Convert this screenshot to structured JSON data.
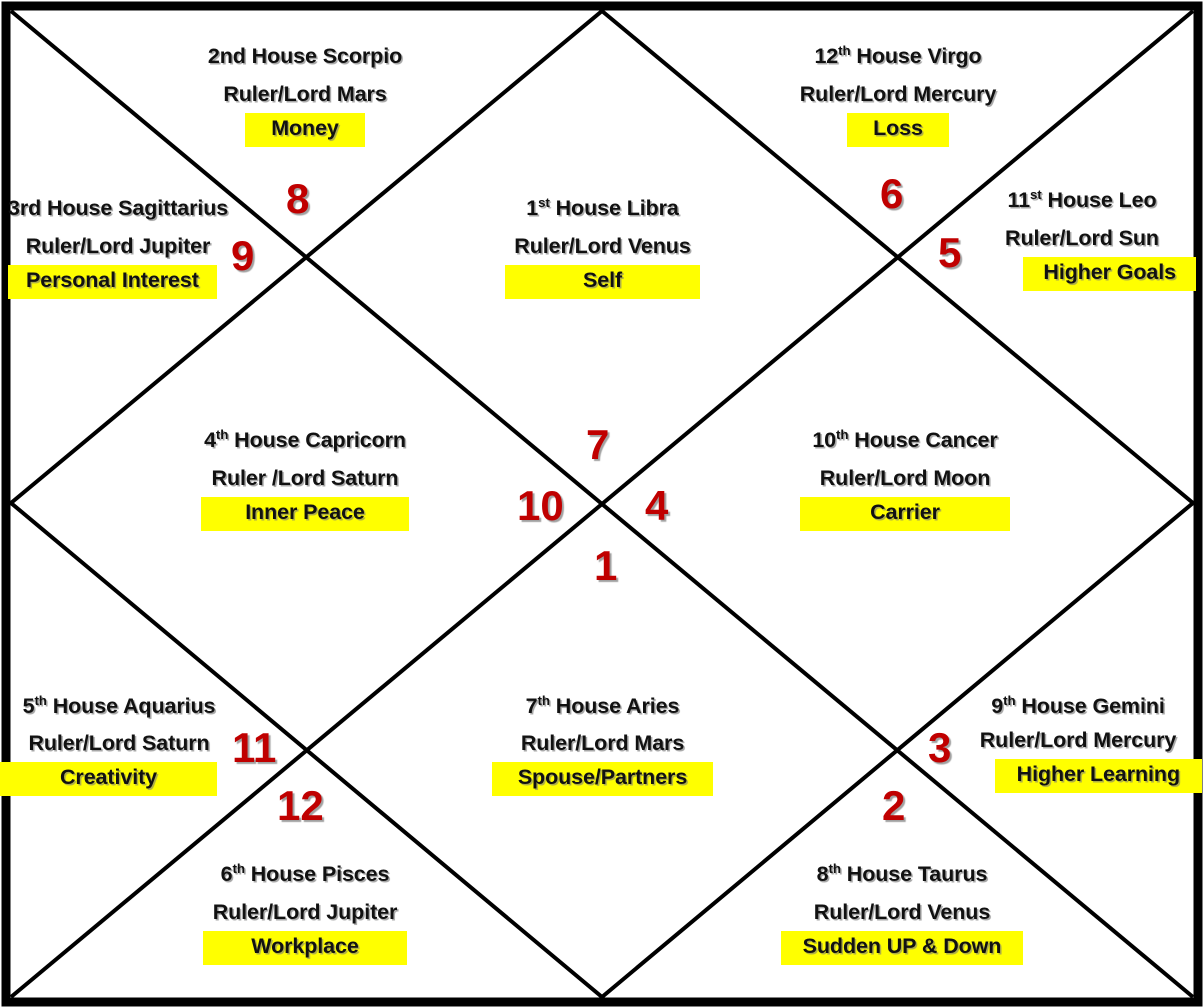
{
  "chart": {
    "kind": "north-indian-vedic-birth-chart",
    "colors": {
      "line": "#000000",
      "border": "#000000",
      "keyword_highlight": "#FFFF00",
      "house_number": "#C00000",
      "text": "#111111",
      "background": "#FFFFFF"
    },
    "labels": {
      "house_word": "House",
      "ruler_prefix": "Ruler/Lord"
    }
  },
  "houses": [
    {
      "number": "1",
      "title_ordinal": "1",
      "title_suffix": "st",
      "title_rest": " House  Libra",
      "title_plain": "1st House  Libra",
      "sign": "Libra",
      "ruler_line": "Ruler/Lord Venus",
      "ruler": "Venus",
      "keyword": "Self"
    },
    {
      "number": "2",
      "title_ordinal": "2nd",
      "title_suffix": "",
      "title_rest": " House  Scorpio",
      "title_plain": "2nd House  Scorpio",
      "sign": "Scorpio",
      "ruler_line": "Ruler/Lord Mars",
      "ruler": "Mars",
      "keyword": "Money"
    },
    {
      "number": "3",
      "title_ordinal": "3rd",
      "title_suffix": "",
      "title_rest": " House Sagittarius",
      "title_plain": "3rd House Sagittarius",
      "sign": "Sagittarius",
      "ruler_line": "Ruler/Lord Jupiter",
      "ruler": "Jupiter",
      "keyword": "Personal Interest"
    },
    {
      "number": "4",
      "title_ordinal": "4",
      "title_suffix": "th",
      "title_rest": " House Capricorn",
      "title_plain": "4th House Capricorn",
      "sign": "Capricorn",
      "ruler_line": "Ruler /Lord Saturn",
      "ruler": "Saturn",
      "keyword": "Inner Peace"
    },
    {
      "number": "5",
      "title_ordinal": "5",
      "title_suffix": "th",
      "title_rest": " House Aquarius",
      "title_plain": "5th House Aquarius",
      "sign": "Aquarius",
      "ruler_line": "Ruler/Lord Saturn",
      "ruler": "Saturn",
      "keyword": "Creativity"
    },
    {
      "number": "6",
      "title_ordinal": "6",
      "title_suffix": "th",
      "title_rest": " House Pisces",
      "title_plain": "6th House Pisces",
      "sign": "Pisces",
      "ruler_line": "Ruler/Lord Jupiter",
      "ruler": "Jupiter",
      "keyword": "Workplace"
    },
    {
      "number": "7",
      "title_ordinal": "7",
      "title_suffix": "th",
      "title_rest": " House  Aries",
      "title_plain": "7th House  Aries",
      "sign": "Aries",
      "ruler_line": "Ruler/Lord Mars",
      "ruler": "Mars",
      "keyword": "Spouse/Partners"
    },
    {
      "number": "8",
      "title_ordinal": "8",
      "title_suffix": "th",
      "title_rest": " House  Taurus",
      "title_plain": "8th House  Taurus",
      "sign": "Taurus",
      "ruler_line": "Ruler/Lord Venus",
      "ruler": "Venus",
      "keyword": "Sudden UP & Down"
    },
    {
      "number": "9",
      "title_ordinal": "9",
      "title_suffix": "th",
      "title_rest": " House  Gemini",
      "title_plain": "9th House  Gemini",
      "sign": "Gemini",
      "ruler_line": "Ruler/Lord Mercury",
      "ruler": "Mercury",
      "keyword": "Higher Learning"
    },
    {
      "number": "10",
      "title_ordinal": "10",
      "title_suffix": "th",
      "title_rest": " House  Cancer",
      "title_plain": "10th House  Cancer",
      "sign": "Cancer",
      "ruler_line": "Ruler/Lord Moon",
      "ruler": "Moon",
      "keyword": "Carrier"
    },
    {
      "number": "11",
      "title_ordinal": "11",
      "title_suffix": "st",
      "title_rest": " House Leo",
      "title_plain": "11st House Leo",
      "sign": "Leo",
      "ruler_line": "Ruler/Lord Sun",
      "ruler": "Sun",
      "keyword": "Higher Goals"
    },
    {
      "number": "12",
      "title_ordinal": "12",
      "title_suffix": "th",
      "title_rest": " House  Virgo",
      "title_plain": "12th House  Virgo",
      "sign": "Virgo",
      "ruler_line": "Ruler/Lord Mercury",
      "ruler": "Mercury",
      "keyword": "Loss"
    }
  ],
  "house_numbers_marks": [
    {
      "value": "8",
      "id": "mark-8"
    },
    {
      "value": "9",
      "id": "mark-9"
    },
    {
      "value": "6",
      "id": "mark-6"
    },
    {
      "value": "5",
      "id": "mark-5"
    },
    {
      "value": "7",
      "id": "mark-7"
    },
    {
      "value": "10",
      "id": "mark-10"
    },
    {
      "value": "4",
      "id": "mark-4"
    },
    {
      "value": "1",
      "id": "mark-1"
    },
    {
      "value": "11",
      "id": "mark-11"
    },
    {
      "value": "12",
      "id": "mark-12"
    },
    {
      "value": "3",
      "id": "mark-3"
    },
    {
      "value": "2",
      "id": "mark-2"
    }
  ]
}
